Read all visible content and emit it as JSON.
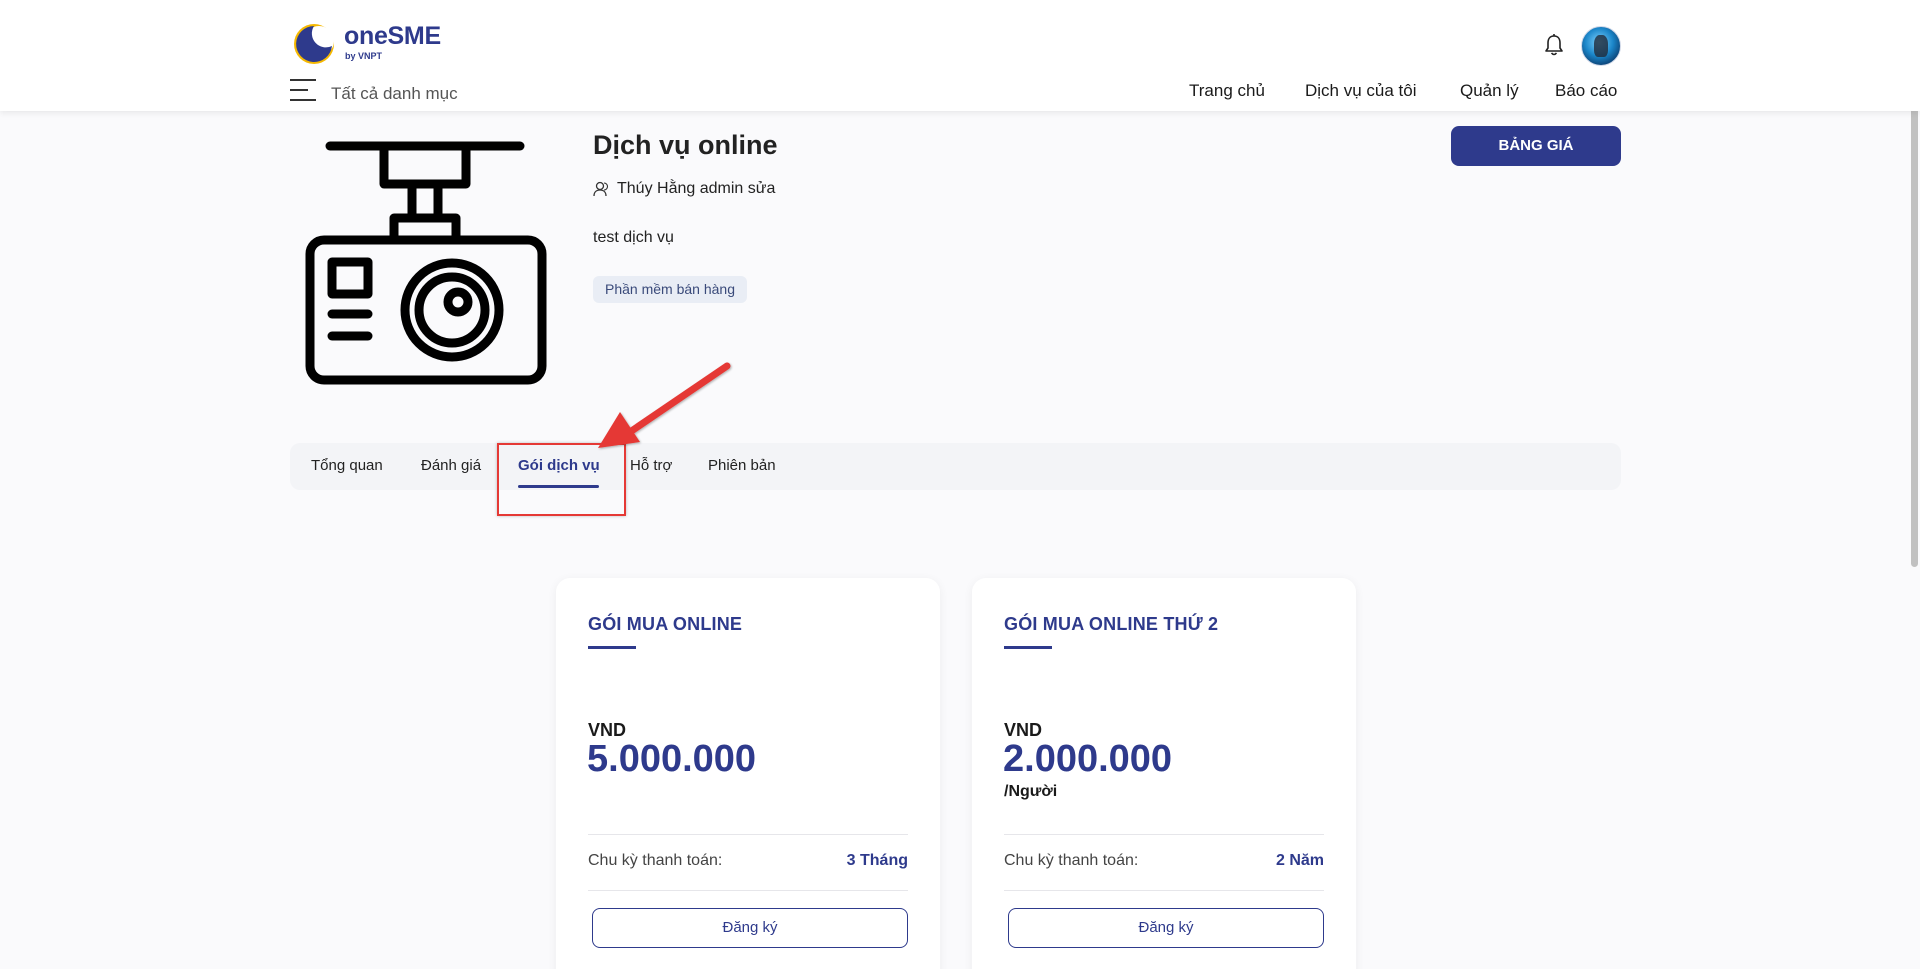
{
  "header": {
    "logo_text": "oneSME",
    "logo_sub": "by VNPT",
    "all_categories": "Tất cả danh mục",
    "nav": [
      "Trang chủ",
      "Dịch vụ của tôi",
      "Quản lý",
      "Báo cáo"
    ]
  },
  "product": {
    "title": "Dịch vụ online",
    "author": "Thúy Hằng admin sửa",
    "description": "test dịch vụ",
    "tag": "Phần mềm bán hàng",
    "price_button": "BẢNG GIÁ"
  },
  "tabs": [
    "Tổng quan",
    "Đánh giá",
    "Gói dịch vụ",
    "Hỗ trợ",
    "Phiên bản"
  ],
  "active_tab": "Gói dịch vụ",
  "plans": [
    {
      "title": "GÓI MUA ONLINE",
      "currency": "VND",
      "amount": "5.000.000",
      "unit": "",
      "cycle_label": "Chu kỳ thanh toán:",
      "cycle_value": "3 Tháng",
      "button": "Đăng ký"
    },
    {
      "title": "GÓI MUA ONLINE THỨ 2",
      "currency": "VND",
      "amount": "2.000.000",
      "unit": "/Người",
      "cycle_label": "Chu kỳ thanh toán:",
      "cycle_value": "2 Năm",
      "button": "Đăng ký"
    }
  ],
  "colors": {
    "brand": "#2e3a8c",
    "accent_yellow": "#f5b800",
    "annotation_red": "#e53935"
  },
  "icons": [
    "logo-mark",
    "menu-icon",
    "bell-icon",
    "avatar",
    "dashcam-icon",
    "user-icon",
    "annotation-arrow"
  ]
}
